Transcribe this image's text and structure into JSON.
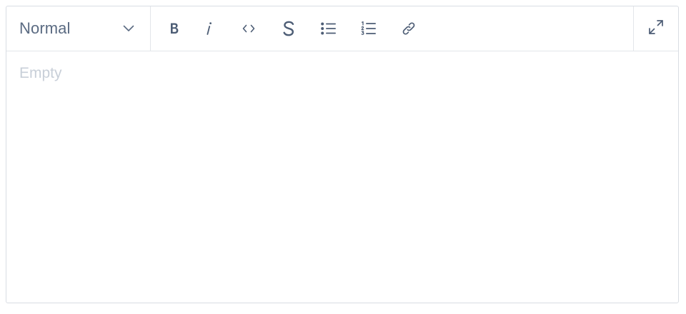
{
  "toolbar": {
    "block_type": {
      "selected": "Normal",
      "icon": "chevron-down-icon"
    },
    "buttons": [
      {
        "name": "bold",
        "icon": "bold-icon"
      },
      {
        "name": "italic",
        "icon": "italic-icon"
      },
      {
        "name": "code",
        "icon": "code-icon"
      },
      {
        "name": "strikethrough",
        "icon": "strikethrough-icon"
      },
      {
        "name": "bulleted-list",
        "icon": "bulleted-list-icon"
      },
      {
        "name": "numbered-list",
        "icon": "numbered-list-icon"
      },
      {
        "name": "link",
        "icon": "link-icon"
      }
    ],
    "expand": {
      "icon": "expand-icon"
    }
  },
  "editor": {
    "placeholder": "Empty"
  },
  "colors": {
    "icon": "#4d5d75",
    "placeholder": "#c8cfd8",
    "border": "#d9dde3"
  }
}
